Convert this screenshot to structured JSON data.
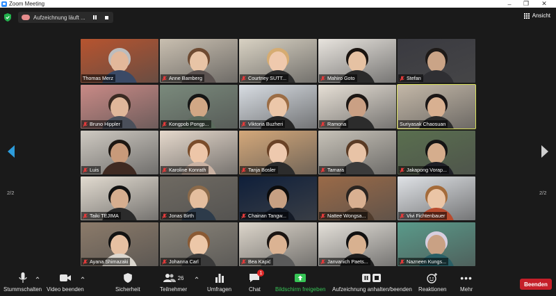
{
  "window": {
    "title": "Zoom Meeting"
  },
  "recording": {
    "status_text": "Aufzeichnung läuft ..."
  },
  "view": {
    "label": "Ansicht"
  },
  "pagination": {
    "page": "2/2"
  },
  "participants": [
    {
      "name": "Thomas Merz",
      "muted": false
    },
    {
      "name": "Anne Bamberg",
      "muted": true
    },
    {
      "name": "Courtney SUTT...",
      "muted": true
    },
    {
      "name": "Mahiro Goto",
      "muted": true
    },
    {
      "name": "Stefan",
      "muted": true
    },
    {
      "name": "Bruno Hippler",
      "muted": true
    },
    {
      "name": "Kongpob Pongp...",
      "muted": true
    },
    {
      "name": "Viktoria Buzheri",
      "muted": true
    },
    {
      "name": "Ramona",
      "muted": true
    },
    {
      "name": "Suriyasak Chaosuan",
      "muted": false
    },
    {
      "name": "Luis",
      "muted": true
    },
    {
      "name": "Karoline Konrath",
      "muted": true
    },
    {
      "name": "Tanja Bosler",
      "muted": true
    },
    {
      "name": "Tamara",
      "muted": true
    },
    {
      "name": "Jakapong Vorap...",
      "muted": true
    },
    {
      "name": "Taiki TEJIMA",
      "muted": true
    },
    {
      "name": "Jonas Birth",
      "muted": true
    },
    {
      "name": "Chainan Tangw...",
      "muted": true
    },
    {
      "name": "Nattee Wongsa...",
      "muted": true
    },
    {
      "name": "Vivi Fichtenbauer",
      "muted": true
    },
    {
      "name": "Ayana Shimazaki",
      "muted": true
    },
    {
      "name": "Johanna Carl",
      "muted": true
    },
    {
      "name": "Bea Kapić",
      "muted": true
    },
    {
      "name": "Janvanich Paets...",
      "muted": true
    },
    {
      "name": "Nazneen Kungs...",
      "muted": true
    }
  ],
  "toolbar": {
    "mute_label": "Stummschalten",
    "video_label": "Video beenden",
    "security_label": "Sicherheit",
    "participants_label": "Teilnehmer",
    "participants_count": "26",
    "polls_label": "Umfragen",
    "chat_label": "Chat",
    "chat_badge": "1",
    "share_label": "Bildschirm freigeben",
    "recording_label": "Aufzeichnung anhalten/beenden",
    "reactions_label": "Reaktionen",
    "more_label": "Mehr",
    "end_label": "Beenden"
  },
  "colors": {
    "share_green": "#37c556",
    "end_red": "#c51f29",
    "active_speaker": "#d9e05a",
    "zoom_blue": "#2d8cff",
    "nav_arrow": "#2d9cdb"
  }
}
